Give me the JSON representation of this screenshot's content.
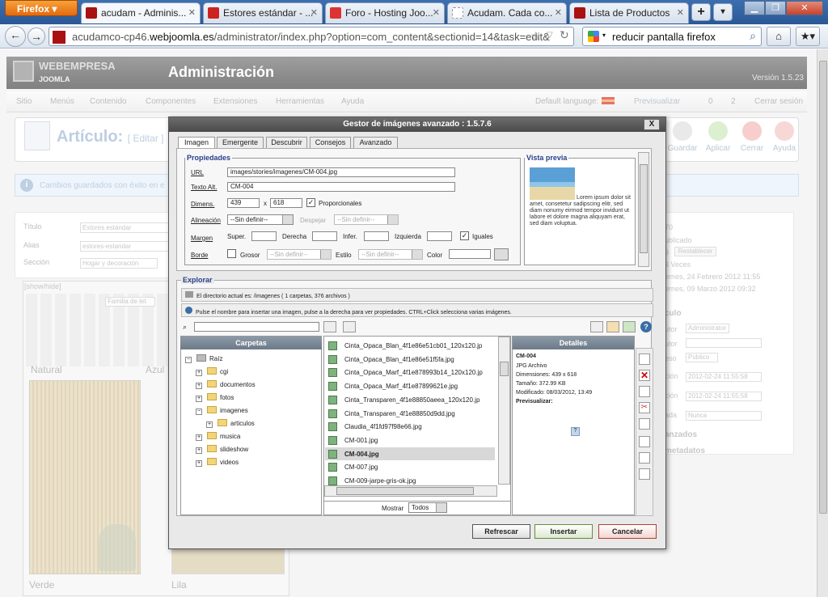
{
  "browser": {
    "app_button": "Firefox",
    "tabs": [
      {
        "label": "acudam - Adminis...",
        "active": true
      },
      {
        "label": "Estores estándar - ...",
        "active": false
      },
      {
        "label": "Foro - Hosting Joo...",
        "active": false
      },
      {
        "label": "Acudam. Cada co...",
        "active": false
      },
      {
        "label": "Lista de Productos",
        "active": false
      }
    ],
    "url_plain": "acudamco-cp46.",
    "url_host": "webjoomla.es",
    "url_path": "/administrator/index.php?option=com_content&sectionid=14&task=edit&",
    "search_value": "reducir pantalla firefox"
  },
  "joomla": {
    "logo": "WEBEMPRESA",
    "logo_sub": "JOOMLA",
    "header_title": "Administración",
    "version": "Versión 1.5.23",
    "menu": [
      "Sitio",
      "Menús",
      "Contenido",
      "Componentes",
      "Extensiones",
      "Herramientas",
      "Ayuda"
    ],
    "status": {
      "default_language": "Default language:",
      "preview": "Previsualizar",
      "count_a": "0",
      "count_b": "2",
      "logout": "Cerrar sesión"
    },
    "page_title": "Artículo:",
    "page_title_action": "[ Editar ]",
    "toolbar": [
      "Guardar",
      "Aplicar",
      "Cerrar",
      "Ayuda"
    ],
    "message": "Cambios guardados con éxito en e",
    "form": {
      "titulo_label": "Título",
      "titulo_value": "Estores estándar",
      "alias_label": "Alias",
      "alias_value": "estores-estandar",
      "seccion_label": "Sección",
      "seccion_value": "Hogar y decoración"
    },
    "editor": {
      "toggle": "[show/hide]",
      "font_family": "Familia de let",
      "cap_natural": "Natural",
      "cap_azul": "Azul",
      "cap_verde": "Verde",
      "cap_lila": "Lila"
    },
    "right": {
      "id": "70",
      "state": "ublicado",
      "hits": "9",
      "reset": "Restablecer",
      "revised": "3 Veces",
      "created": "ernes, 24 Febrero 2012 11:55",
      "modified": "ernes, 09 Marzo 2012 09:32",
      "section_title": "culo",
      "author_label": "utor",
      "author_value": "Administrator",
      "alias_label": "utor",
      "access_label": "eso",
      "access_value": "Público",
      "date1_label": "ción",
      "date1_value": "2012-02-24 11:55:58",
      "date2_label": "ción",
      "date2_value": "2012-02-24 11:55:58",
      "finish_label": "ada",
      "finish_value": "Nunca",
      "advanced": "anzados",
      "metadata": "metadatos"
    }
  },
  "dialog": {
    "title": "Gestor de imágenes avanzado : 1.5.7.6",
    "close": "X",
    "tabs": [
      "Imagen",
      "Emergente",
      "Descubrir",
      "Consejos",
      "Avanzado"
    ],
    "props_legend": "Propiedades",
    "url_label": "URL",
    "url_value": "images/stories/imagenes/CM-004.jpg",
    "alt_label": "Texto Alt.",
    "alt_value": "CM-004",
    "dim_label": "Dimens.",
    "width": "439",
    "times": "x",
    "height": "618",
    "proportional": "Proporcionales",
    "align_label": "Alineación",
    "align_value": "--Sin definir--",
    "clear_label": "Despejar",
    "clear_value": "--Sin definir--",
    "margin_label": "Margen",
    "top_label": "Super.",
    "right_label": "Derecha",
    "bottom_label": "Infer.",
    "left_label": "Izquierda",
    "equal_label": "Iguales",
    "border_label": "Borde",
    "thickness_label": "Grosor",
    "thickness_value": "--Sin definir--",
    "style_label": "Estilo",
    "style_value": "--Sin definir--",
    "color_label": "Color",
    "preview_legend": "Vista previa",
    "preview_text": "Lorem ipsum dolor sit amet, consetetur sadipscing elitr, sed diam nonumy eirmod tempor invidunt ut labore et dolore magna aliquyam erat, sed diam voluptua.",
    "explorer_legend": "Explorar",
    "dir_info": "El directorio actual es: /imagenes ( 1 carpetas, 376 archivos )",
    "hint": "Pulse el nombre para insertar una imagen, pulse a la derecha para ver propiedades. CTRL+Click selecciona varias imágenes.",
    "folders_title": "Carpetas",
    "details_title": "Detalles",
    "tree": [
      {
        "label": "Raíz",
        "indent": 0,
        "pm": "−"
      },
      {
        "label": "cgi",
        "indent": 1,
        "pm": "+"
      },
      {
        "label": "documentos",
        "indent": 1,
        "pm": "+"
      },
      {
        "label": "fotos",
        "indent": 1,
        "pm": "+"
      },
      {
        "label": "imagenes",
        "indent": 1,
        "pm": "−"
      },
      {
        "label": "articulos",
        "indent": 2,
        "pm": "+"
      },
      {
        "label": "musica",
        "indent": 1,
        "pm": "+"
      },
      {
        "label": "slideshow",
        "indent": 1,
        "pm": "+"
      },
      {
        "label": "videos",
        "indent": 1,
        "pm": "+"
      }
    ],
    "files": [
      {
        "name": "Cinta_Opaca_Blan_4f1e86e51cb01_120x120.jp",
        "selected": false
      },
      {
        "name": "Cinta_Opaca_Blan_4f1e86e51f5fa.jpg",
        "selected": false
      },
      {
        "name": "Cinta_Opaca_Marf_4f1e878993b14_120x120.jp",
        "selected": false
      },
      {
        "name": "Cinta_Opaca_Marf_4f1e87899621e.jpg",
        "selected": false
      },
      {
        "name": "Cinta_Transparen_4f1e88850aeea_120x120.jp",
        "selected": false
      },
      {
        "name": "Cinta_Transparen_4f1e88850d9dd.jpg",
        "selected": false
      },
      {
        "name": "Claudia_4f1fd97f98e66.jpg",
        "selected": false
      },
      {
        "name": "CM-001.jpg",
        "selected": false
      },
      {
        "name": "CM-004.jpg",
        "selected": true
      },
      {
        "name": "CM-007.jpg",
        "selected": false
      },
      {
        "name": "CM-009-jarpe-gris-ok.jpg",
        "selected": false
      }
    ],
    "details": {
      "name": "CM-004",
      "type": "JPG Archivo",
      "dims": "Dimensiones: 439 x 618",
      "size": "Tamaño: 372.99 KB",
      "modified": "Modificado: 08/03/2012, 13:49",
      "preview": "Previsualizar:"
    },
    "show_label": "Mostrar",
    "show_value": "Todos",
    "refresh": "Refrescar",
    "insert": "Insertar",
    "cancel": "Cancelar"
  },
  "colors": {
    "accent": "#2a5895",
    "dialog_title": "#4a4a4a",
    "link": "#27408b"
  }
}
